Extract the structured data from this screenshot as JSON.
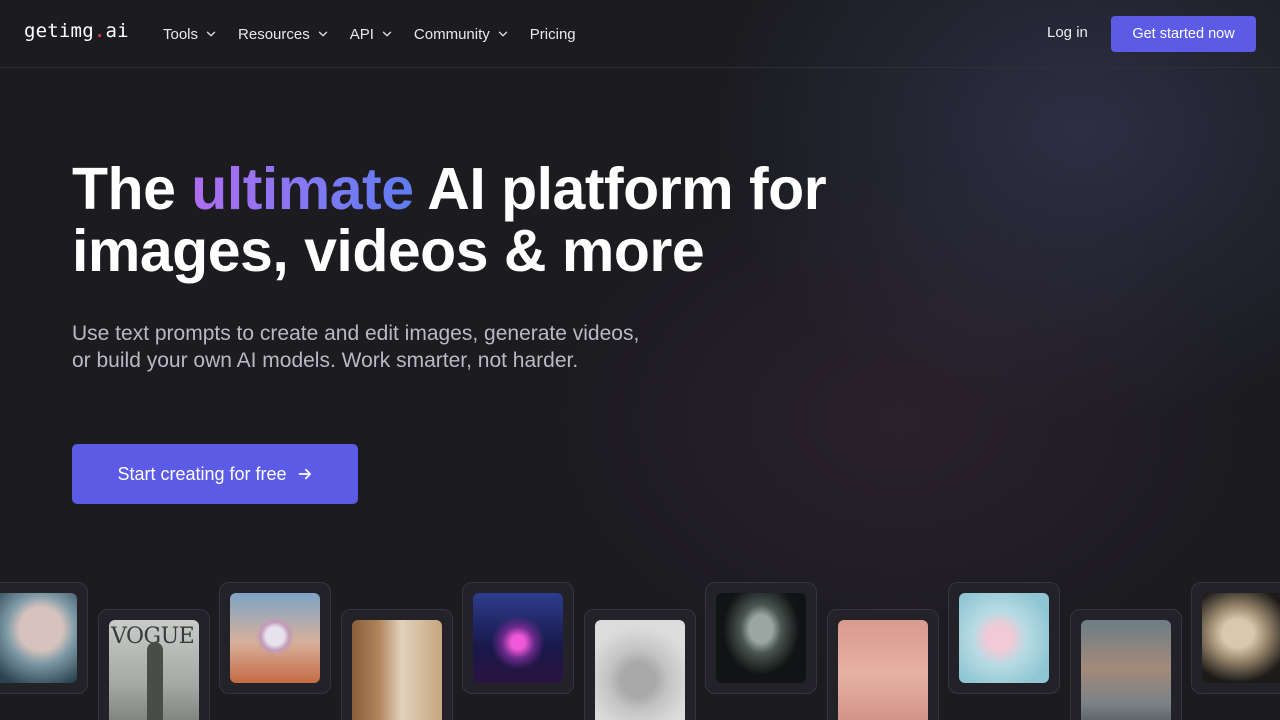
{
  "logo": {
    "part1": "getimg",
    "dot": ".",
    "part2": "ai"
  },
  "nav": {
    "items": [
      {
        "label": "Tools",
        "has_dropdown": true
      },
      {
        "label": "Resources",
        "has_dropdown": true
      },
      {
        "label": "API",
        "has_dropdown": true
      },
      {
        "label": "Community",
        "has_dropdown": true
      },
      {
        "label": "Pricing",
        "has_dropdown": false
      }
    ],
    "login_label": "Log in",
    "cta_label": "Get started now"
  },
  "hero": {
    "title_before": "The ",
    "title_accent": "ultimate",
    "title_line1_after": " AI platform for",
    "title_line2": "images, videos & more",
    "subtitle": "Use text prompts to create and edit images, generate videos, or build your own AI models. Work smarter, not harder.",
    "cta_label": "Start creating for free",
    "cta_icon": "arrow-right-icon"
  },
  "gallery": {
    "cards": [
      {
        "name": "gallery-portrait-woman",
        "text": ""
      },
      {
        "name": "gallery-vogue-cover",
        "text": "VOGUE"
      },
      {
        "name": "gallery-glass-sphere",
        "text": ""
      },
      {
        "name": "gallery-wooden-room",
        "text": ""
      },
      {
        "name": "gallery-neon-robot",
        "text": ""
      },
      {
        "name": "gallery-wire-sculpture",
        "text": ""
      },
      {
        "name": "gallery-alien-figure",
        "text": ""
      },
      {
        "name": "gallery-pink-room",
        "text": ""
      },
      {
        "name": "gallery-glass-figure",
        "text": ""
      },
      {
        "name": "gallery-astronaut-doorway",
        "text": ""
      },
      {
        "name": "gallery-android-head",
        "text": ""
      }
    ]
  },
  "colors": {
    "background": "#1b1b20",
    "brand_button": "#5b5be6",
    "logo_dot": "#e0415f",
    "accent_gradient_start": "#b06cf0",
    "accent_gradient_end": "#5f7cf0"
  }
}
